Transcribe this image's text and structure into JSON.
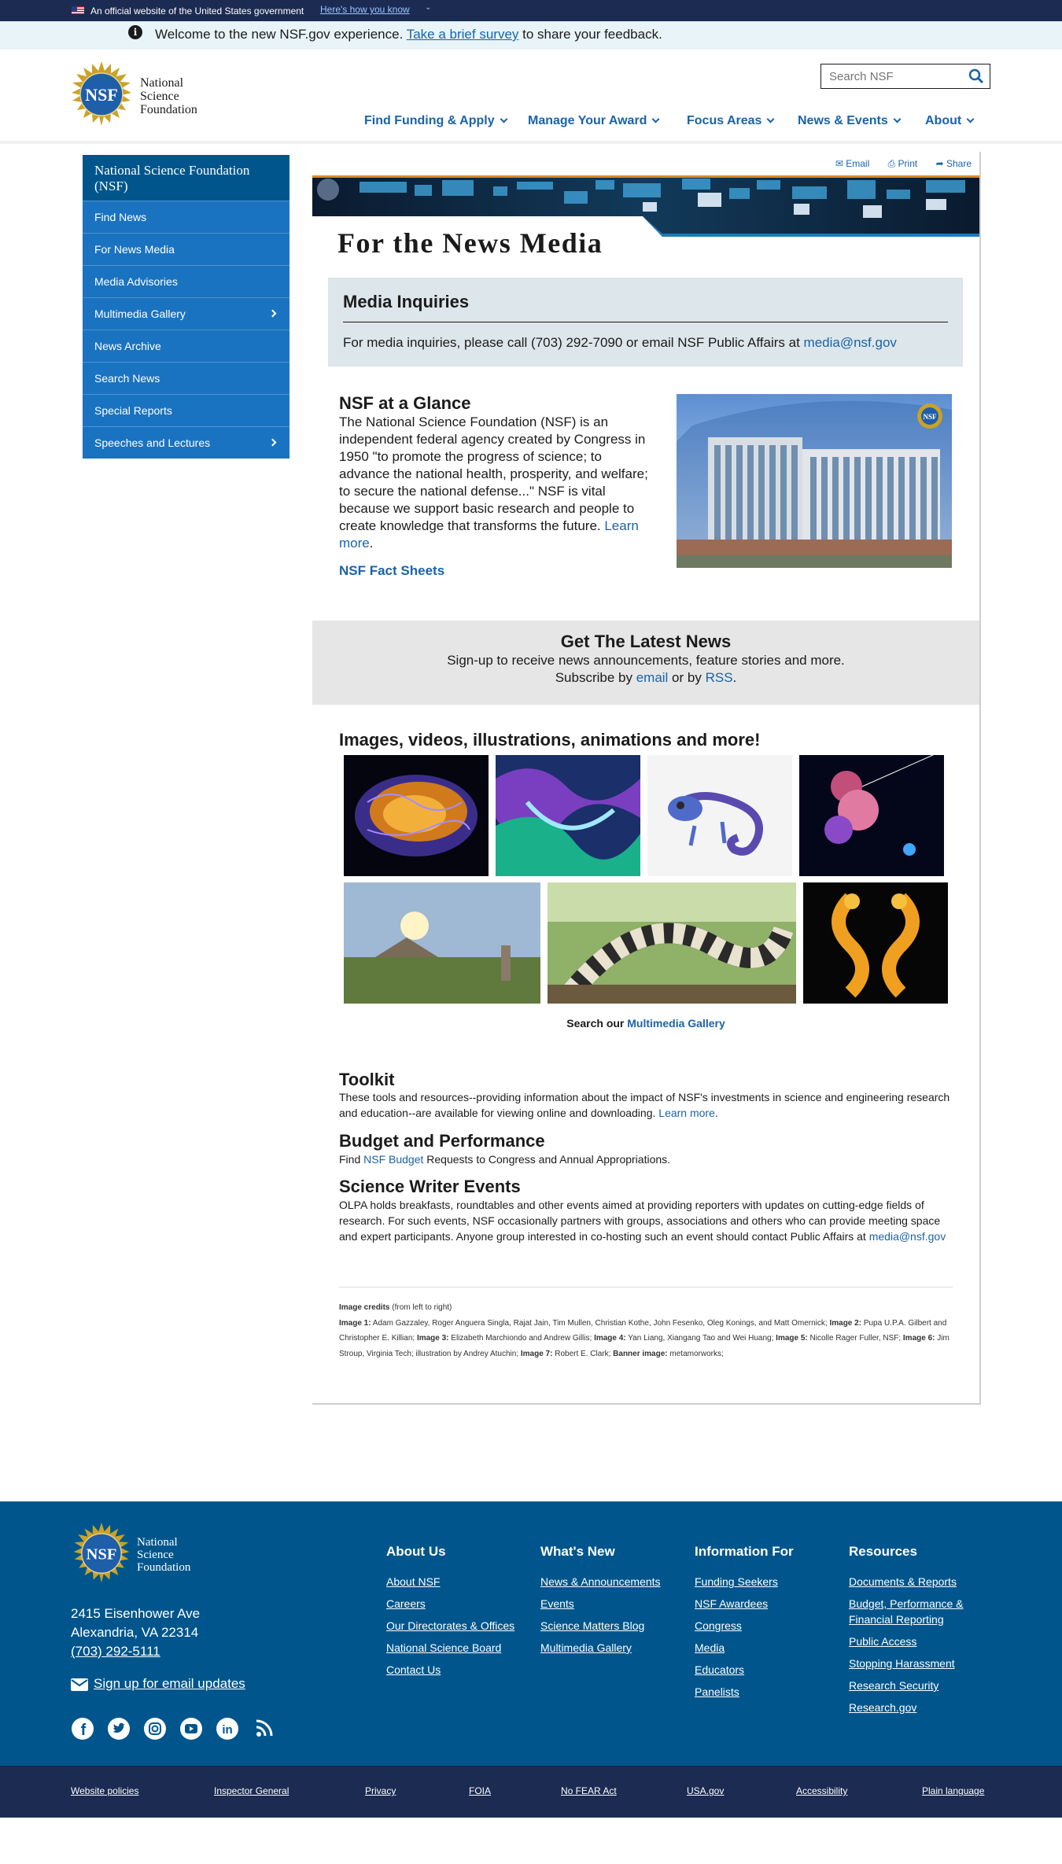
{
  "gov_banner": {
    "official_text": "An official website of the United States government",
    "how_link": "Here's how you know"
  },
  "survey_bar": {
    "prefix": "Welcome to the new NSF.gov experience. ",
    "link": "Take a brief survey",
    "suffix": " to share your feedback."
  },
  "header": {
    "logo_line1": "National",
    "logo_line2": "Science",
    "logo_line3": "Foundation",
    "search_placeholder": "Search NSF",
    "nav": [
      "Find Funding & Apply",
      "Manage Your Award",
      "Focus Areas",
      "News & Events",
      "About"
    ]
  },
  "sidebar": {
    "title": "National Science Foundation (NSF)",
    "items": [
      {
        "label": "Find News",
        "has_submenu": false
      },
      {
        "label": "For News Media",
        "has_submenu": false
      },
      {
        "label": "Media Advisories",
        "has_submenu": false
      },
      {
        "label": "Multimedia Gallery",
        "has_submenu": true
      },
      {
        "label": "News Archive",
        "has_submenu": false
      },
      {
        "label": "Search News",
        "has_submenu": false
      },
      {
        "label": "Special Reports",
        "has_submenu": false
      },
      {
        "label": "Speeches and Lectures",
        "has_submenu": true
      }
    ]
  },
  "share_tools": {
    "email": "Email",
    "print": "Print",
    "share": "Share"
  },
  "page_title": "For the News Media",
  "inquiries": {
    "title": "Media Inquiries",
    "text": "For media inquiries, please call (703) 292-7090 or email NSF Public Affairs at ",
    "email": "media@nsf.gov"
  },
  "glance": {
    "title": "NSF at a Glance",
    "text": "The National Science Foundation (NSF) is an independent federal agency created by Congress in 1950 \"to promote the progress of science; to advance the national health, prosperity, and welfare; to secure the national defense...\" NSF is vital because we support basic research and people to create knowledge that transforms the future. ",
    "learn_more": "Learn more",
    "learn_more_suffix": ".",
    "fact_sheets": "NSF Fact Sheets"
  },
  "latest": {
    "title": "Get The Latest News",
    "line1": "Sign-up to receive news announcements, feature stories and more.",
    "subscribe_prefix": "Subscribe by ",
    "email": "email",
    "or": " or by ",
    "rss": "RSS",
    "end": "."
  },
  "media": {
    "title": "Images, videos, illustrations, animations and more!",
    "caption_prefix": "Search our ",
    "caption_link": "Multimedia Gallery"
  },
  "toolkit": {
    "title": "Toolkit",
    "text": "These tools and resources--providing information about the impact of NSF's investments in science and engineering research and education--are available for viewing online and downloading. ",
    "link": "Learn more",
    "end": "."
  },
  "budget": {
    "title": "Budget and Performance",
    "prefix": "Find ",
    "link": "NSF Budget",
    "suffix": " Requests to Congress and Annual Appropriations."
  },
  "writer_events": {
    "title": "Science Writer Events",
    "text": "OLPA holds breakfasts, roundtables and other events aimed at providing reporters with updates on cutting-edge fields of research. For such events, NSF occasionally partners with groups, associations and others who can provide meeting space and expert participants. Anyone group interested in co-hosting such an event should contact Public Affairs at ",
    "email": "media@nsf.gov"
  },
  "credits": {
    "heading": "Image credits",
    "heading_note": " (from left to right)",
    "items": [
      {
        "label": "Image 1:",
        "text": " Adam Gazzaley, Roger Anguera Singla, Rajat Jain, Tim Mullen, Christian Kothe, John Fesenko, Oleg Konings, and Matt Omernick; "
      },
      {
        "label": "Image 2:",
        "text": " Pupa U.P.A. Gilbert and Christopher E. Killian; "
      },
      {
        "label": "Image 3:",
        "text": " Elizabeth Marchiondo and Andrew Gillis; "
      },
      {
        "label": "Image 4:",
        "text": " Yan Liang, Xiangang Tao and Wei Huang; "
      },
      {
        "label": "Image 5:",
        "text": " Nicolle Rager Fuller, NSF; "
      },
      {
        "label": "Image 6:",
        "text": " Jim Stroup, Virginia Tech; illustration by Andrey Atuchin; "
      },
      {
        "label": "Image 7:",
        "text": " Robert E. Clark; "
      },
      {
        "label": "Banner image:",
        "text": " metamorworks;"
      }
    ]
  },
  "footer": {
    "logo_line1": "National",
    "logo_line2": "Science",
    "logo_line3": "Foundation",
    "address1": "2415 Eisenhower Ave",
    "address2": "Alexandria, VA 22314",
    "phone": "(703) 292-5111",
    "email_signup": "Sign up for email updates",
    "social": [
      "facebook-icon",
      "twitter-icon",
      "instagram-icon",
      "youtube-icon",
      "linkedin-icon",
      "rss-icon"
    ],
    "columns": [
      {
        "title": "About Us",
        "links": [
          "About NSF",
          "Careers",
          "Our Directorates & Offices",
          "National Science Board",
          "Contact Us"
        ]
      },
      {
        "title": "What's New",
        "links": [
          "News & Announcements",
          "Events",
          "Science Matters Blog",
          "Multimedia Gallery"
        ]
      },
      {
        "title": "Information For",
        "links": [
          "Funding Seekers",
          "NSF Awardees",
          "Congress",
          "Media",
          "Educators",
          "Panelists"
        ]
      },
      {
        "title": "Resources",
        "links": [
          "Documents & Reports",
          "Budget, Performance & Financial Reporting",
          "Public Access",
          "Stopping Harassment",
          "Research Security",
          "Research.gov"
        ]
      }
    ],
    "bottom_links": [
      "Website policies",
      "Inspector General",
      "Privacy",
      "FOIA",
      "No FEAR Act",
      "USA.gov",
      "Accessibility",
      "Plain language"
    ]
  },
  "colors": {
    "gov_banner": "#1b2b52",
    "brand_blue": "#00568c",
    "link_blue": "#1a63a8",
    "sidebar_item": "#1a73c0"
  }
}
